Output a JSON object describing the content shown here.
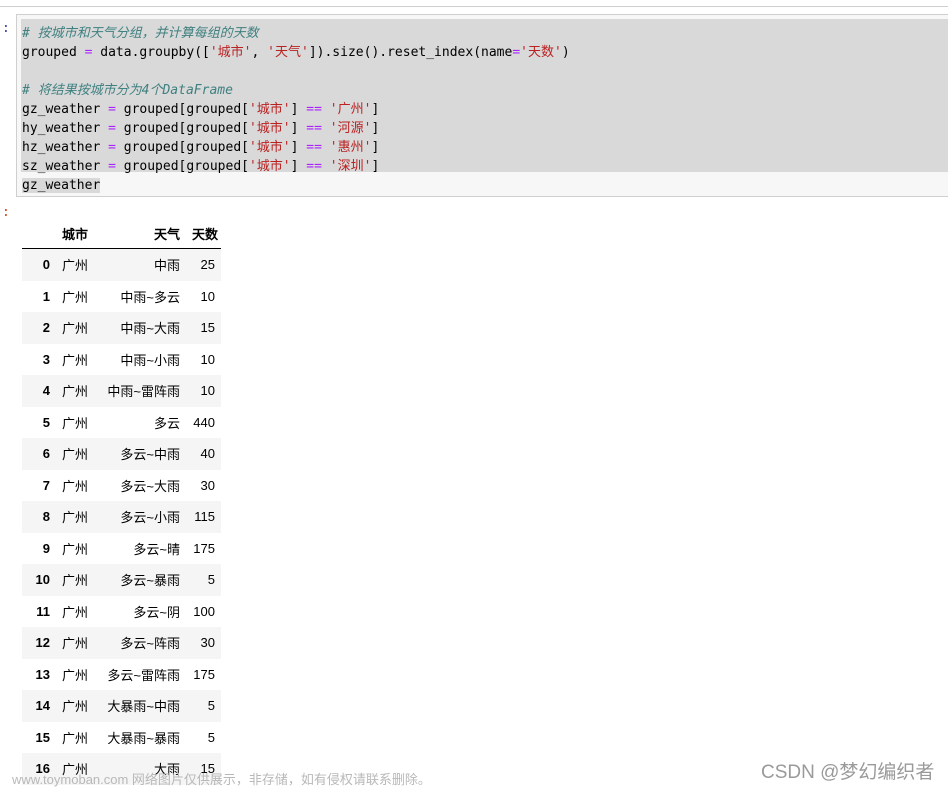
{
  "cell": {
    "in_prompt": ":",
    "out_prompt": ":",
    "code": [
      {
        "tokens": [
          {
            "t": "# 按城市和天气分组，并计算每组的天数",
            "c": "comment"
          }
        ]
      },
      {
        "tokens": [
          {
            "t": "grouped ",
            "c": ""
          },
          {
            "t": "=",
            "c": "op"
          },
          {
            "t": " data.groupby([",
            "c": ""
          },
          {
            "t": "'城市'",
            "c": "str"
          },
          {
            "t": ", ",
            "c": ""
          },
          {
            "t": "'天气'",
            "c": "str"
          },
          {
            "t": "]).size().reset_index(name",
            "c": ""
          },
          {
            "t": "=",
            "c": "op"
          },
          {
            "t": "'天数'",
            "c": "str"
          },
          {
            "t": ")",
            "c": ""
          }
        ]
      },
      {
        "tokens": []
      },
      {
        "tokens": [
          {
            "t": "# 将结果按城市分为4个DataFrame",
            "c": "comment"
          }
        ]
      },
      {
        "tokens": [
          {
            "t": "gz_weather ",
            "c": ""
          },
          {
            "t": "=",
            "c": "op"
          },
          {
            "t": " grouped[grouped[",
            "c": ""
          },
          {
            "t": "'城市'",
            "c": "str"
          },
          {
            "t": "] ",
            "c": ""
          },
          {
            "t": "==",
            "c": "op"
          },
          {
            "t": " ",
            "c": ""
          },
          {
            "t": "'广州'",
            "c": "str"
          },
          {
            "t": "]",
            "c": ""
          }
        ]
      },
      {
        "tokens": [
          {
            "t": "hy_weather ",
            "c": ""
          },
          {
            "t": "=",
            "c": "op"
          },
          {
            "t": " grouped[grouped[",
            "c": ""
          },
          {
            "t": "'城市'",
            "c": "str"
          },
          {
            "t": "] ",
            "c": ""
          },
          {
            "t": "==",
            "c": "op"
          },
          {
            "t": " ",
            "c": ""
          },
          {
            "t": "'河源'",
            "c": "str"
          },
          {
            "t": "]",
            "c": ""
          }
        ]
      },
      {
        "tokens": [
          {
            "t": "hz_weather ",
            "c": ""
          },
          {
            "t": "=",
            "c": "op"
          },
          {
            "t": " grouped[grouped[",
            "c": ""
          },
          {
            "t": "'城市'",
            "c": "str"
          },
          {
            "t": "] ",
            "c": ""
          },
          {
            "t": "==",
            "c": "op"
          },
          {
            "t": " ",
            "c": ""
          },
          {
            "t": "'惠州'",
            "c": "str"
          },
          {
            "t": "]",
            "c": ""
          }
        ]
      },
      {
        "tokens": [
          {
            "t": "sz_weather ",
            "c": ""
          },
          {
            "t": "=",
            "c": "op"
          },
          {
            "t": " grouped[grouped[",
            "c": ""
          },
          {
            "t": "'城市'",
            "c": "str"
          },
          {
            "t": "] ",
            "c": ""
          },
          {
            "t": "==",
            "c": "op"
          },
          {
            "t": " ",
            "c": ""
          },
          {
            "t": "'深圳'",
            "c": "str"
          },
          {
            "t": "]",
            "c": ""
          }
        ]
      },
      {
        "tokens": [
          {
            "t": "gz_weather",
            "c": "last-sel"
          }
        ]
      }
    ]
  },
  "table": {
    "headers": [
      "",
      "城市",
      "天气",
      "天数"
    ],
    "rows": [
      [
        "0",
        "广州",
        "中雨",
        "25"
      ],
      [
        "1",
        "广州",
        "中雨~多云",
        "10"
      ],
      [
        "2",
        "广州",
        "中雨~大雨",
        "15"
      ],
      [
        "3",
        "广州",
        "中雨~小雨",
        "10"
      ],
      [
        "4",
        "广州",
        "中雨~雷阵雨",
        "10"
      ],
      [
        "5",
        "广州",
        "多云",
        "440"
      ],
      [
        "6",
        "广州",
        "多云~中雨",
        "40"
      ],
      [
        "7",
        "广州",
        "多云~大雨",
        "30"
      ],
      [
        "8",
        "广州",
        "多云~小雨",
        "115"
      ],
      [
        "9",
        "广州",
        "多云~晴",
        "175"
      ],
      [
        "10",
        "广州",
        "多云~暴雨",
        "5"
      ],
      [
        "11",
        "广州",
        "多云~阴",
        "100"
      ],
      [
        "12",
        "广州",
        "多云~阵雨",
        "30"
      ],
      [
        "13",
        "广州",
        "多云~雷阵雨",
        "175"
      ],
      [
        "14",
        "广州",
        "大暴雨~中雨",
        "5"
      ],
      [
        "15",
        "广州",
        "大暴雨~暴雨",
        "5"
      ],
      [
        "16",
        "广州",
        "大雨",
        "15"
      ]
    ]
  },
  "watermarks": {
    "left": "www.toymoban.com 网络图片仅供展示，非存储，如有侵权请联系删除。",
    "right": "CSDN @梦幻编织者"
  }
}
